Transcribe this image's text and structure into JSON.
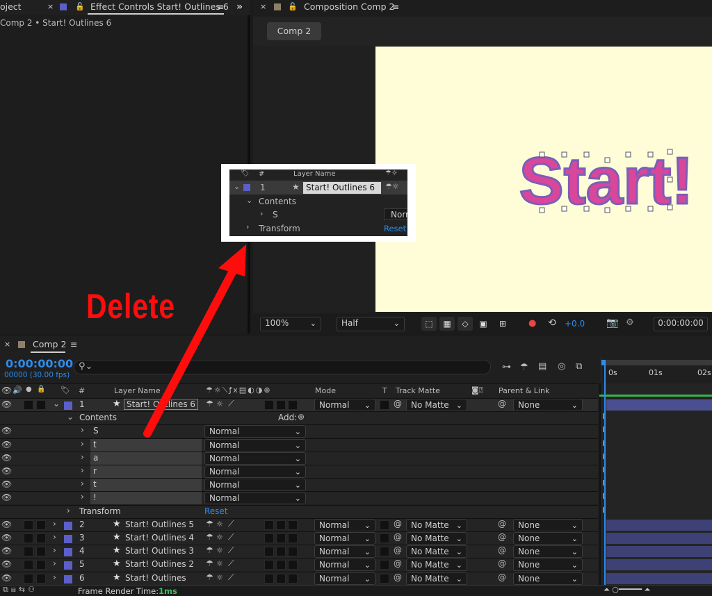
{
  "left_panel": {
    "tab_project": "oject",
    "tab_effect_controls": "Effect Controls Start! Outlines 6",
    "breadcrumb": "Comp 2 • Start! Outlines 6",
    "color": "#5b5fc7"
  },
  "comp_panel": {
    "tab": "Composition Comp 2",
    "comp_button": "Comp 2",
    "canvas_bg": "#fffdd8",
    "comp_text": "Start!",
    "zoom": "100%",
    "resolution": "Half",
    "exposure": "+0.0",
    "timecode": "0:00:00:00"
  },
  "annotation": {
    "delete_text": "Delete",
    "arrow_color": "#ff0d0d",
    "inset": {
      "col_num": "#",
      "col_name": "Layer Name",
      "layer_num": "1",
      "layer_name": "Start! Outlines 6",
      "contents": "Contents",
      "item": "S",
      "mode": "Norr",
      "transform": "Transform",
      "reset": "Reset"
    }
  },
  "timeline": {
    "tab": "Comp 2",
    "timecode": "0:00:00:00",
    "fps": "00000 (30.00 fps)",
    "search_placeholder": "",
    "columns": {
      "num": "#",
      "layer_name": "Layer Name",
      "mode": "Mode",
      "t": "T",
      "track_matte": "Track Matte",
      "parent": "Parent & Link"
    },
    "ruler": [
      "0s",
      "01s",
      "02s"
    ],
    "selected_layer": {
      "num": "1",
      "name": "Start! Outlines 6",
      "mode": "Normal",
      "matte": "No Matte",
      "parent": "None"
    },
    "contents_label": "Contents",
    "add_label": "Add:",
    "contents_items": [
      {
        "name": "S",
        "mode": "Normal"
      },
      {
        "name": "t",
        "mode": "Normal"
      },
      {
        "name": "a",
        "mode": "Normal"
      },
      {
        "name": "r",
        "mode": "Normal"
      },
      {
        "name": "t",
        "mode": "Normal"
      },
      {
        "name": "!",
        "mode": "Normal"
      }
    ],
    "transform_label": "Transform",
    "reset_label": "Reset",
    "other_layers": [
      {
        "num": "2",
        "name": "Start! Outlines 5",
        "mode": "Normal",
        "matte": "No Matte",
        "parent": "None"
      },
      {
        "num": "3",
        "name": "Start! Outlines 4",
        "mode": "Normal",
        "matte": "No Matte",
        "parent": "None"
      },
      {
        "num": "4",
        "name": "Start! Outlines 3",
        "mode": "Normal",
        "matte": "No Matte",
        "parent": "None"
      },
      {
        "num": "5",
        "name": "Start! Outlines 2",
        "mode": "Normal",
        "matte": "No Matte",
        "parent": "None"
      },
      {
        "num": "6",
        "name": "Start! Outlines",
        "mode": "Normal",
        "matte": "No Matte",
        "parent": "None"
      }
    ],
    "frame_render_label": "Frame Render Time:",
    "frame_render_value": "1ms",
    "accent": "#2d8ceb",
    "layer_color": "#5b5fc7"
  }
}
